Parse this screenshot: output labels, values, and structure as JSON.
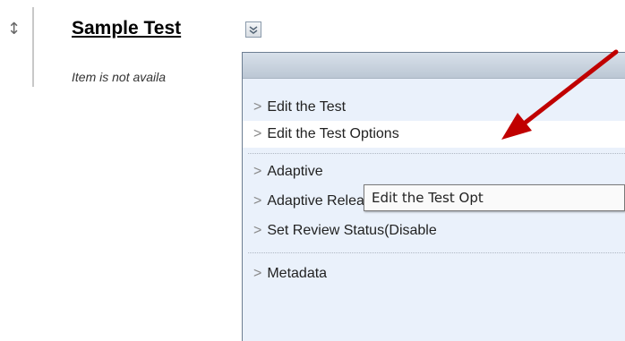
{
  "content_item": {
    "title": "Sample Test",
    "status_text": "Item is not availa"
  },
  "context_menu": {
    "items": [
      {
        "label": "Edit the Test"
      },
      {
        "label": "Edit the Test Options"
      },
      {
        "label": "Adaptive"
      },
      {
        "label": "Adaptive Release: Advanc"
      },
      {
        "label": "Set Review Status(Disable"
      },
      {
        "label": "Metadata"
      }
    ],
    "bullet": ">"
  },
  "tooltip": {
    "text": "Edit the Test Opt"
  },
  "colors": {
    "arrow": "#c00000",
    "menu_bg": "#eaf1fb"
  },
  "icons": {
    "drag_handle": "↕",
    "chevron": "chevron-down-icon"
  }
}
